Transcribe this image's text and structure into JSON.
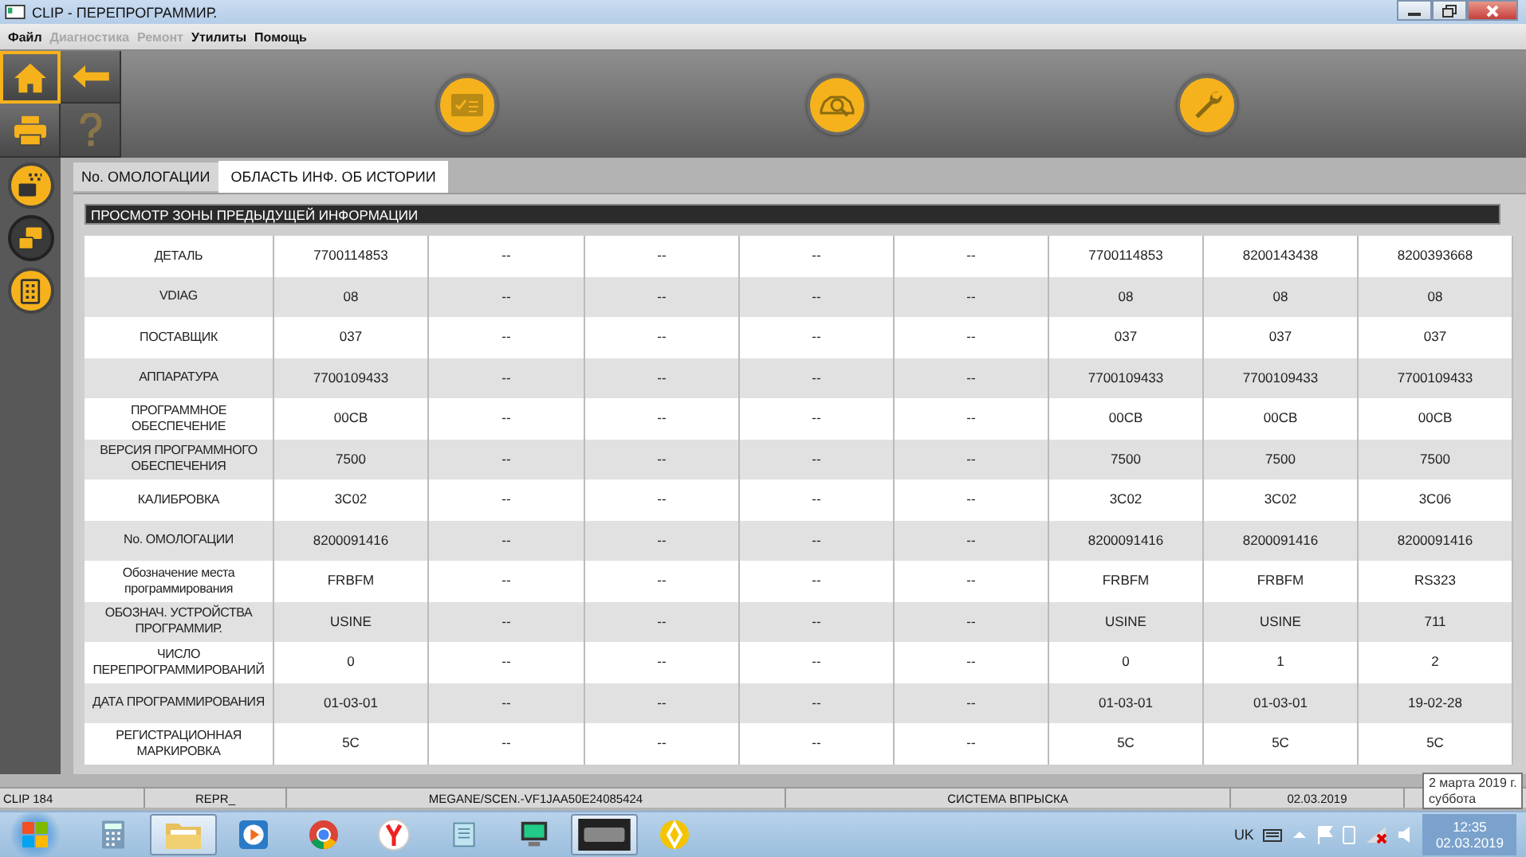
{
  "window": {
    "title": "CLIP - ПЕРЕПРОГРАММИР."
  },
  "menu": [
    {
      "label": "Файл",
      "disabled": false
    },
    {
      "label": "Диагностика",
      "disabled": true
    },
    {
      "label": "Ремонт",
      "disabled": true
    },
    {
      "label": "Утилиты",
      "disabled": false
    },
    {
      "label": "Помощь",
      "disabled": false
    }
  ],
  "nav_buttons": [
    {
      "kind": "home",
      "selected": true,
      "disabled": false
    },
    {
      "kind": "back",
      "selected": false,
      "disabled": false
    },
    {
      "kind": "print",
      "selected": false,
      "disabled": false
    },
    {
      "kind": "help",
      "selected": false,
      "disabled": true
    }
  ],
  "tabs": [
    {
      "label": "No. ОМОЛОГАЦИИ",
      "selected": false
    },
    {
      "label": "ОБЛАСТЬ ИНФ. ОБ ИСТОРИИ",
      "selected": true
    }
  ],
  "section_title": "ПРОСМОТР ЗОНЫ ПРЕДЫДУЩЕЙ ИНФОРМАЦИИ",
  "table": {
    "rows": [
      {
        "label": "ДЕТАЛЬ",
        "values": [
          "7700114853",
          "--",
          "--",
          "--",
          "--",
          "7700114853",
          "8200143438",
          "8200393668"
        ]
      },
      {
        "label": "VDIAG",
        "values": [
          "08",
          "--",
          "--",
          "--",
          "--",
          "08",
          "08",
          "08"
        ]
      },
      {
        "label": "ПОСТАВЩИК",
        "values": [
          "037",
          "--",
          "--",
          "--",
          "--",
          "037",
          "037",
          "037"
        ]
      },
      {
        "label": "АППАРАТУРА",
        "values": [
          "7700109433",
          "--",
          "--",
          "--",
          "--",
          "7700109433",
          "7700109433",
          "7700109433"
        ]
      },
      {
        "label": "ПРОГРАММНОЕ ОБЕСПЕЧЕНИЕ",
        "values": [
          "00CB",
          "--",
          "--",
          "--",
          "--",
          "00CB",
          "00CB",
          "00CB"
        ]
      },
      {
        "label": "ВЕРСИЯ ПРОГРАММНОГО ОБЕСПЕЧЕНИЯ",
        "values": [
          "7500",
          "--",
          "--",
          "--",
          "--",
          "7500",
          "7500",
          "7500"
        ]
      },
      {
        "label": "КАЛИБРОВКА",
        "values": [
          "3C02",
          "--",
          "--",
          "--",
          "--",
          "3C02",
          "3C02",
          "3C06"
        ]
      },
      {
        "label": "No. ОМОЛОГАЦИИ",
        "values": [
          "8200091416",
          "--",
          "--",
          "--",
          "--",
          "8200091416",
          "8200091416",
          "8200091416"
        ]
      },
      {
        "label": "Обозначение места программирования",
        "values": [
          "FRBFM",
          "--",
          "--",
          "--",
          "--",
          "FRBFM",
          "FRBFM",
          "RS323"
        ]
      },
      {
        "label": "ОБОЗНАЧ. УСТРОЙСТВА ПРОГРАММИР.",
        "values": [
          "USINE",
          "--",
          "--",
          "--",
          "--",
          "USINE",
          "USINE",
          "711"
        ]
      },
      {
        "label": "ЧИСЛО ПЕРЕПРОГРАММИРОВАНИЙ",
        "values": [
          "0",
          "--",
          "--",
          "--",
          "--",
          "0",
          "1",
          "2"
        ]
      },
      {
        "label": "ДАТА ПРОГРАММИРОВАНИЯ",
        "values": [
          "01-03-01",
          "--",
          "--",
          "--",
          "--",
          "01-03-01",
          "01-03-01",
          "19-02-28"
        ]
      },
      {
        "label": "РЕГИСТРАЦИОННАЯ МАРКИРОВКА",
        "values": [
          "5C",
          "--",
          "--",
          "--",
          "--",
          "5C",
          "5C",
          "5C"
        ]
      }
    ]
  },
  "status_bar": [
    "CLIP 184",
    "REPR_",
    "MEGANE/SCEN.-VF1JAA50E24085424",
    "СИСТЕМА ВПРЫСКА",
    "02.03.2019"
  ],
  "tooltip": [
    "2 марта 2019 г.",
    "суббота"
  ],
  "taskbar": {
    "apps": [
      {
        "kind": "calculator",
        "selected": false
      },
      {
        "kind": "folder",
        "selected": true
      },
      {
        "kind": "media",
        "selected": false
      },
      {
        "kind": "chrome",
        "selected": false
      },
      {
        "kind": "yandex",
        "selected": false
      },
      {
        "kind": "notepad",
        "selected": false
      },
      {
        "kind": "computer",
        "selected": false
      },
      {
        "kind": "clip",
        "selected": true
      },
      {
        "kind": "renault",
        "selected": false
      }
    ],
    "language": "UK",
    "time": "12:35",
    "date": "02.03.2019"
  }
}
